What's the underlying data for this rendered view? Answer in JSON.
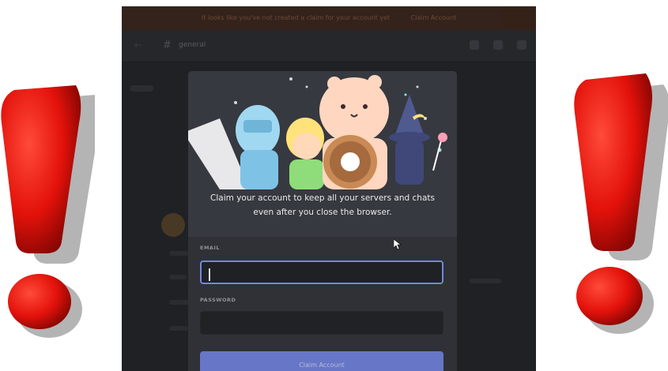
{
  "banner": {
    "text_left": "It looks like you've not created a claim for your account yet",
    "text_right": "Claim Account"
  },
  "channel": {
    "hash": "#",
    "name": "general"
  },
  "modal": {
    "headline_line1": "Claim your account to keep all your servers and chats",
    "headline_line2": "even after you close the browser.",
    "email_label": "EMAIL",
    "email_value": "",
    "password_label": "PASSWORD",
    "button_label": "Claim Account"
  },
  "colors": {
    "accent": "#7289da",
    "warning_red": "#e3120b",
    "modal_bg": "#36393f",
    "form_bg": "#2f3136"
  },
  "icons": [
    "exclamation-mark-icon",
    "mouse-pointer-icon",
    "wumpus-illustration"
  ]
}
